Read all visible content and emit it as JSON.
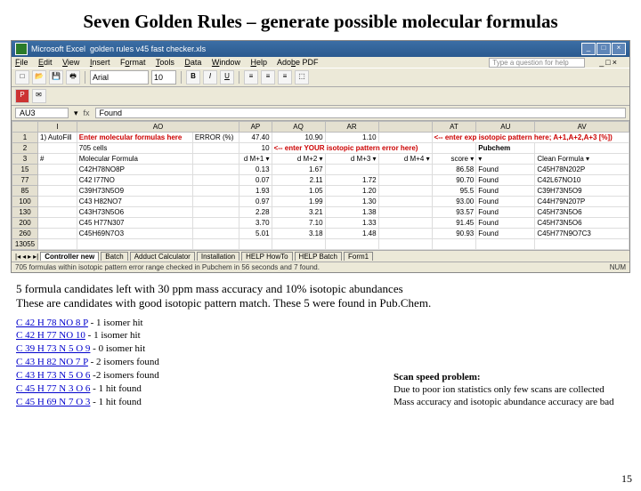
{
  "title": "Seven Golden Rules – generate possible molecular formulas",
  "excel": {
    "app": "Microsoft Excel",
    "file": "golden rules v45 fast checker.xls",
    "menus": [
      "File",
      "Edit",
      "View",
      "Insert",
      "Format",
      "Tools",
      "Data",
      "Window",
      "Help",
      "Adobe PDF"
    ],
    "question_prompt": "Type a question for help",
    "font": "Arial",
    "fontsize": "10",
    "namebox": "AU3",
    "formula": "Found",
    "hdr_instr": "Enter molecular formulas here",
    "hdr_err": "ERROR (%)",
    "hdr_iso_instr": "<-- enter exp isotopic pattern here; A+1,A+2,A+3 [%])",
    "hdr_yourpat": "<-- enter YOUR isotopic pattern error here)",
    "hdr_num": "705 cells",
    "hdr_mf": "Molecular Formula",
    "hdr_m1": "d M+1",
    "hdr_m2": "d M+2",
    "hdr_m3": "d M+3",
    "hdr_m4": "d M+4",
    "hdr_score": "score",
    "hdr_pubchem": "Pubchem",
    "hdr_clean": "Clean Formula",
    "A1v": "47.40",
    "A2v": "10.90",
    "A3v": "1.10",
    "errtop": "10",
    "rows": [
      {
        "rn": "15",
        "mf": "C42H78NO8P",
        "m1": "0.13",
        "m2": "1.67",
        "score": "86.58",
        "pc": "Found",
        "cf": "C45H78N202P"
      },
      {
        "rn": "77",
        "mf": "C42 I77NO",
        "m1": "0.07",
        "m2": "2.11",
        "m3": "1.72",
        "score": "90.70",
        "pc": "Found",
        "cf": "C42L67NO10"
      },
      {
        "rn": "85",
        "mf": "C39H73N5O9",
        "m1": "1.93",
        "m2": "1.05",
        "m3": "1.20",
        "score": "95.5",
        "pc": "Found",
        "cf": "C39H73N5O9"
      },
      {
        "rn": "100",
        "mf": "C43 H82NO7",
        "m1": "0.97",
        "m2": "1.99",
        "m3": "1.30",
        "score": "93.00",
        "pc": "Found",
        "cf": "C44H79N207P"
      },
      {
        "rn": "130",
        "mf": "C43H73N5O6",
        "m1": "2.28",
        "m2": "3.21",
        "m3": "1.38",
        "score": "93.57",
        "pc": "Found",
        "cf": "C45H73N5O6"
      },
      {
        "rn": "200",
        "mf": "C45 H77N307",
        "m1": "3.70",
        "m2": "7.10",
        "m3": "1.33",
        "score": "91.45",
        "pc": "Found",
        "cf": "C45H73N5O6"
      },
      {
        "rn": "260",
        "mf": "C45H69N7O3",
        "m1": "5.01",
        "m2": "3.18",
        "m3": "1.48",
        "score": "90.93",
        "pc": "Found",
        "cf": "C45H77N9O7C3"
      },
      {
        "rn": "13055",
        "mf": "",
        "m1": "",
        "m2": "",
        "m3": "",
        "score": "",
        "pc": "",
        "cf": ""
      }
    ],
    "tabs": [
      "Controller new",
      "Batch",
      "Adduct Calculator",
      "Installation",
      "HELP HowTo",
      "HELP Batch",
      "Form1"
    ],
    "status": "705 formulas within isotopic pattern error range checked in Pubchem in 56 seconds and 7 found.",
    "status_right": "NUM"
  },
  "para1": "5 formula candidates left with 30 ppm mass accuracy and 10% isotopic abundances",
  "para2": "These are candidates with good isotopic pattern match. These 5 were found in Pub.Chem.",
  "hits": [
    {
      "f": "C 42 H 78 NO 8 P",
      "t": " - 1 isomer hit"
    },
    {
      "f": "C 42 H 77 NO 10",
      "t": " - 1 isomer hit"
    },
    {
      "f": "C 39 H 73 N 5 O 9",
      "t": " - 0 isomer hit"
    },
    {
      "f": "C 43 H 82 NO 7 P",
      "t": " - 2 isomers found"
    },
    {
      "f": "C 43 H 73 N 5 O 6",
      "t": " -2 isomers found"
    },
    {
      "f": "C 45 H 77 N 3 O 6",
      "t": " - 1 hit found"
    },
    {
      "f": "C 45 H 69 N 7 O 3",
      "t": " - 1 hit found"
    }
  ],
  "scan": {
    "h": "Scan speed problem:",
    "l1": "Due to poor ion statistics only few scans are collected",
    "l2": "Mass accuracy and isotopic abundance accuracy are bad"
  },
  "pagenum": "15"
}
